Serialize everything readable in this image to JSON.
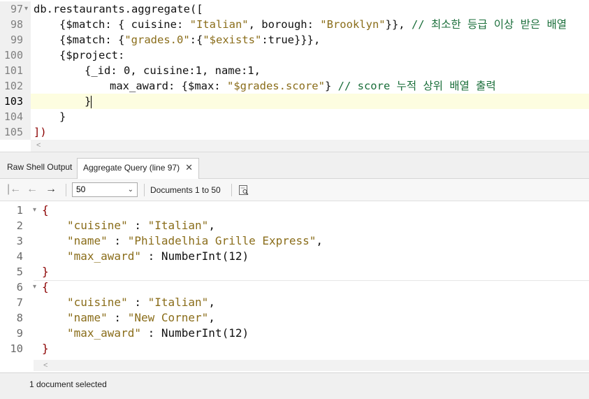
{
  "editor": {
    "lines": [
      {
        "num": "97",
        "fold": "▾"
      },
      {
        "num": "98"
      },
      {
        "num": "99"
      },
      {
        "num": "100"
      },
      {
        "num": "101"
      },
      {
        "num": "102"
      },
      {
        "num": "103"
      },
      {
        "num": "104"
      },
      {
        "num": "105"
      }
    ],
    "code": {
      "l97": "db.restaurants.aggregate([",
      "l98_match": "{$match: { cuisine: ",
      "l98_italian": "\"Italian\"",
      "l98_borough": ", borough: ",
      "l98_brooklyn": "\"Brooklyn\"",
      "l98_close": "}}, ",
      "l98_comment": "// 최소한 등급 이상 받은 배열",
      "l99_open": "{$match: {",
      "l99_key": "\"grades.0\"",
      "l99_colon": ":{",
      "l99_exists": "\"$exists\"",
      "l99_true": ":true}}},",
      "l100": "{$project:",
      "l101": "{_id: 0, cuisine:1, name:1,",
      "l102_key": "max_award: {$max: ",
      "l102_val": "\"$grades.score\"",
      "l102_close": "} ",
      "l102_comment": "// score 누적 상위 배열 출력",
      "l103": "}",
      "l104": "}",
      "l105": "])"
    },
    "scroll_left_arrow": "<"
  },
  "tabs": [
    {
      "label": "Raw Shell Output"
    },
    {
      "label": "Aggregate Query (line 97)",
      "close": "✕"
    }
  ],
  "toolbar": {
    "first_icon": "|←",
    "prev_icon": "←",
    "next_icon": "→",
    "page_size": "50",
    "page_size_chevron": "⌄",
    "documents_range": "Documents 1 to 50"
  },
  "results": {
    "line_numbers": [
      "1",
      "2",
      "3",
      "4",
      "5",
      "6",
      "7",
      "8",
      "9",
      "10"
    ],
    "doc1": {
      "open": "{",
      "cuisine_key": "\"cuisine\"",
      "cuisine_val": "\"Italian\"",
      "name_key": "\"name\"",
      "name_val": "\"Philadelhia Grille Express\"",
      "award_key": "\"max_award\"",
      "award_fn": "NumberInt(",
      "award_num": "12",
      "award_close": ")",
      "close": "}"
    },
    "doc2": {
      "open": "{",
      "cuisine_key": "\"cuisine\"",
      "cuisine_val": "\"Italian\"",
      "name_key": "\"name\"",
      "name_val": "\"New Corner\"",
      "award_key": "\"max_award\"",
      "award_fn": "NumberInt(",
      "award_num": "12",
      "award_close": ")",
      "close": "}"
    },
    "sep_colon": " : ",
    "sep_comma": ",",
    "scroll_left_arrow": "<"
  },
  "status": {
    "text": "1 document selected"
  },
  "colors": {
    "string": "#8a6d1a",
    "comment": "#1a6e3a",
    "bracket": "#8b0000",
    "current_line": "#fdfde0"
  }
}
